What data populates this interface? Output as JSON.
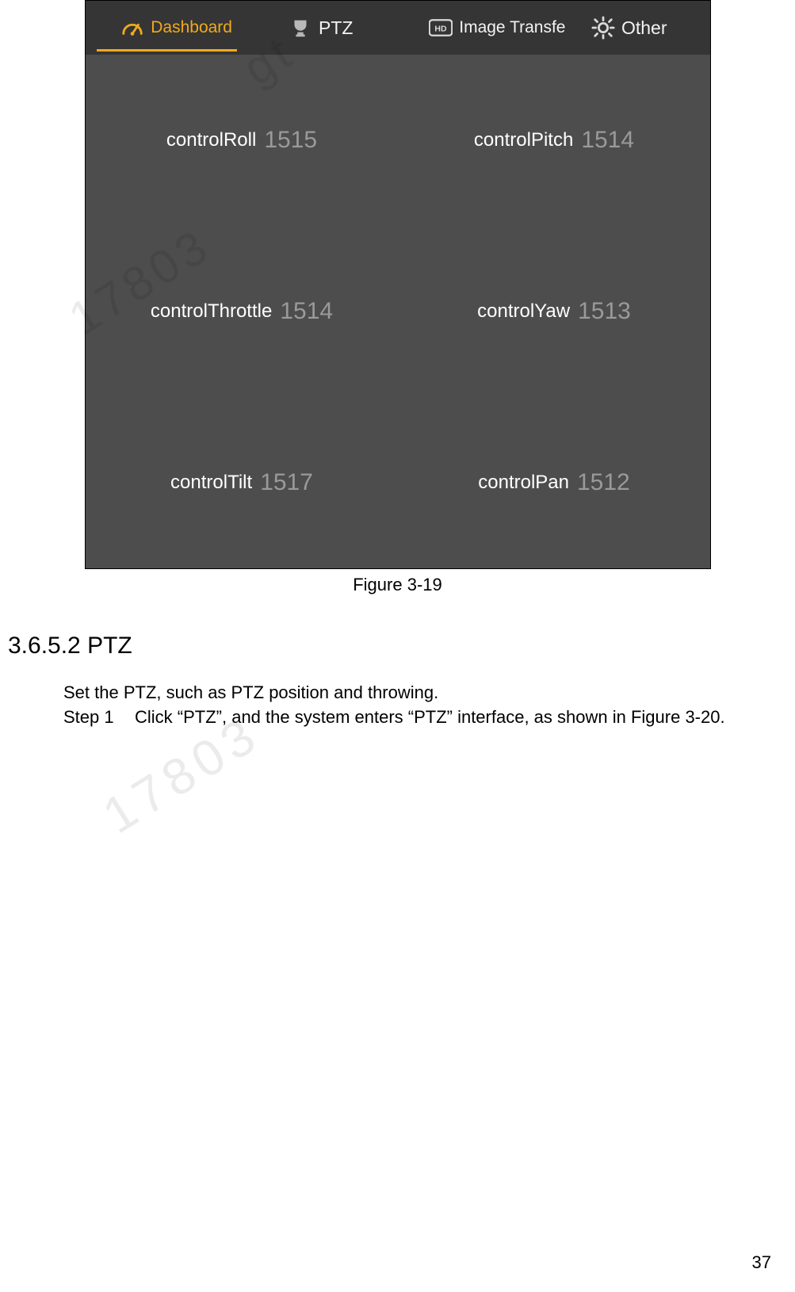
{
  "tabs": {
    "dashboard": "Dashboard",
    "ptz": "PTZ",
    "image_transfer": "Image Transfe",
    "other": "Other"
  },
  "readings": {
    "r0": {
      "name": "controlRoll",
      "value": "1515"
    },
    "r1": {
      "name": "controlPitch",
      "value": "1514"
    },
    "r2": {
      "name": "controlThrottle",
      "value": "1514"
    },
    "r3": {
      "name": "controlYaw",
      "value": "1513"
    },
    "r4": {
      "name": "controlTilt",
      "value": "1517"
    },
    "r5": {
      "name": "controlPan",
      "value": "1512"
    }
  },
  "doc": {
    "figure_caption": "Figure 3-19",
    "section_heading": "3.6.5.2 PTZ",
    "paragraph": "Set the PTZ, such as PTZ position and throwing.",
    "step_label": "Step 1",
    "step_text": "Click “PTZ”, and the system enters “PTZ” interface, as shown in Figure 3-20.",
    "page_number": "37"
  },
  "watermark": {
    "upper_a": "gt",
    "upper_b": "17803"
  }
}
